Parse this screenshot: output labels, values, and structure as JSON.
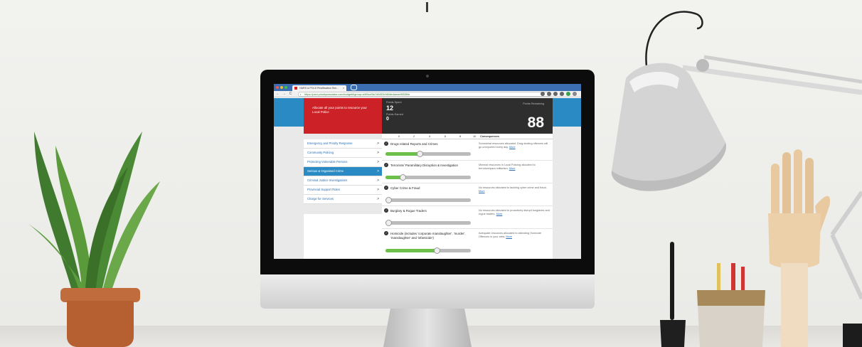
{
  "browser": {
    "tab_title": "HARS & POLS Prioritisation Sim...",
    "tab_close": "×",
    "url": "https://pani.prioritysimulator.com/budget#!group=a9f5ccf9a7d0452b9848e4aeae9553f0e",
    "nav_back": "←",
    "nav_forward": "→",
    "nav_reload": "C"
  },
  "header": {
    "red_card_text": "Allocate all your points to resource your Local Police",
    "points_spent_label": "Points Spent",
    "points_spent_value": "12",
    "points_earned_label": "Points Earned",
    "points_earned_value": "0",
    "points_remaining_label": "Points Remaining",
    "points_remaining_value": "88"
  },
  "scale": {
    "ticks": [
      "0",
      "2",
      "4",
      "6",
      "8",
      "10"
    ],
    "consequences_header": "Consequences"
  },
  "sidebar": {
    "items": [
      {
        "label": "Emergency and Priority Response",
        "active": false
      },
      {
        "label": "Community Policing",
        "active": false
      },
      {
        "label": "Protecting Vulnerable Persons",
        "active": false
      },
      {
        "label": "Serious & Organised Crime",
        "active": true
      },
      {
        "label": "Criminal Justice Investigations",
        "active": false
      },
      {
        "label": "Provincial Support Roles",
        "active": false
      },
      {
        "label": "Charge for Services",
        "active": false
      }
    ],
    "chevron": ">"
  },
  "rows": [
    {
      "title": "Drugs related Reports and Crimes",
      "level": 0.4,
      "consequence": "Somewhat resources allocated. Drug dealing offences will go unreported every day.",
      "more": "More"
    },
    {
      "title": "Terrorism/ Paramilitary Disruption & Investigation",
      "level": 0.2,
      "consequence": "Minimal resources in Local Policing allocated to terrorism/para militarism.",
      "more": "More"
    },
    {
      "title": "Cyber Crime & Fraud",
      "level": 0.0,
      "consequence": "No resources allocated to tackling cyber crime and fraud.",
      "more": "More"
    },
    {
      "title": "Burglary & Rogue Traders",
      "level": 0.0,
      "consequence": "No resources allocated to proactively disrupt burglaries and rogue traders.",
      "more": "More"
    },
    {
      "title": "Homicide (includes 'corporate manslaughter', 'murder', 'manslaughter' and 'infanticide')",
      "level": 0.6,
      "consequence": "Adequate resources allocated to attending Homicide Offences in your area.",
      "more": "More"
    }
  ],
  "info_glyph": "i",
  "apple_glyph": "",
  "colors": {
    "brand_blue": "#2a8bc4",
    "alert_red": "#cc2126",
    "dark_panel": "#2e2e2e",
    "slider_green": "#6cc04a"
  }
}
